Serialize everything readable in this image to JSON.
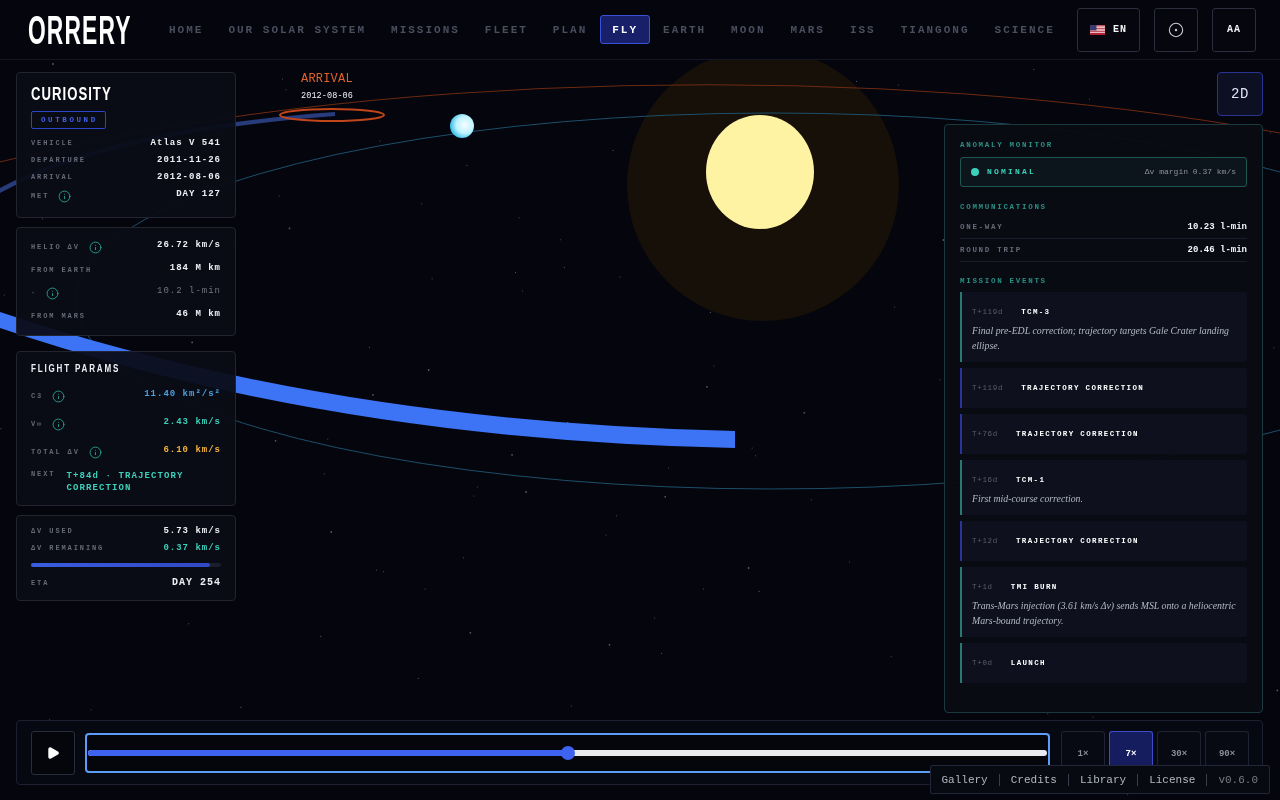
{
  "header": {
    "logo": "ORRERY",
    "nav": [
      {
        "label": "HOME",
        "selected": false
      },
      {
        "label": "OUR SOLAR SYSTEM",
        "selected": false
      },
      {
        "label": "MISSIONS",
        "selected": false
      },
      {
        "label": "FLEET",
        "selected": false
      },
      {
        "label": "PLAN",
        "selected": false
      },
      {
        "label": "FLY",
        "selected": true
      },
      {
        "label": "EARTH",
        "selected": false
      },
      {
        "label": "MOON",
        "selected": false
      },
      {
        "label": "MARS",
        "selected": false
      },
      {
        "label": "ISS",
        "selected": false
      },
      {
        "label": "TIANGONG",
        "selected": false
      },
      {
        "label": "SCIENCE",
        "selected": false
      }
    ],
    "language": "EN",
    "text_size": "AA"
  },
  "scene": {
    "arrival": {
      "title": "ARRIVAL",
      "date": "2012-08-06"
    },
    "view_mode": "2D"
  },
  "mission_card": {
    "name": "CURIOSITY",
    "status": "OUTBOUND",
    "rows": [
      {
        "label": "VEHICLE",
        "value": "Atlas V 541",
        "info": false
      },
      {
        "label": "DEPARTURE",
        "value": "2011-11-26",
        "info": false
      },
      {
        "label": "ARRIVAL",
        "value": "2012-08-06",
        "info": false
      },
      {
        "label": "MET",
        "value": "DAY 127",
        "info": true
      }
    ]
  },
  "distance_card": {
    "rows": [
      {
        "label": "HELIO ΔV",
        "value": "26.72 km/s",
        "info": true,
        "muted": false
      },
      {
        "label": "FROM EARTH",
        "value": "184 M km",
        "info": false,
        "muted": false
      },
      {
        "label": "·",
        "value": "10.2 l-min",
        "info": true,
        "muted": true
      },
      {
        "label": "FROM MARS",
        "value": "46 M km",
        "info": false,
        "muted": false
      }
    ]
  },
  "flight_params": {
    "title": "FLIGHT PARAMS",
    "rows": [
      {
        "label": "C3",
        "value": "11.40 km²/s²",
        "info": true,
        "color": "#4a9fdf"
      },
      {
        "label": "V∞",
        "value": "2.43 km/s",
        "info": true,
        "color": "#3ccfba"
      },
      {
        "label": "TOTAL ΔV",
        "value": "6.10 km/s",
        "info": true,
        "color": "#f3b43c"
      }
    ],
    "next": {
      "label": "NEXT",
      "value": "T+84d · TRAJECTORY CORRECTION"
    }
  },
  "budget_card": {
    "rows": [
      {
        "label": "ΔV USED",
        "value": "5.73 km/s",
        "color": "#eef0f5"
      },
      {
        "label": "ΔV REMAINING",
        "value": "0.37 km/s",
        "color": "#3ccfba"
      }
    ],
    "progress": {
      "level": 0.94
    },
    "eta": {
      "label": "ETA",
      "value": "DAY 254"
    }
  },
  "monitor_panel": {
    "anomaly": {
      "title": "ANOMALY MONITOR",
      "status": "NOMINAL",
      "color": "#3ccfba",
      "margin": "Δv margin 0.37 km/s"
    },
    "communications": {
      "title": "COMMUNICATIONS",
      "rows": [
        {
          "label": "ONE-WAY",
          "value": "10.23 l-min"
        },
        {
          "label": "ROUND TRIP",
          "value": "20.46 l-min"
        }
      ]
    },
    "events": {
      "title": "MISSION EVENTS",
      "items": [
        {
          "time": "T+119d",
          "title": "TCM-3",
          "description": "Final pre-EDL correction; trajectory targets Gale Crater landing ellipse.",
          "color": "#267a72"
        },
        {
          "time": "T+119d",
          "title": "TRAJECTORY CORRECTION",
          "color": "#29359a"
        },
        {
          "time": "T+76d",
          "title": "TRAJECTORY CORRECTION",
          "color": "#29359a"
        },
        {
          "time": "T+16d",
          "title": "TCM-1",
          "description": "First mid-course correction.",
          "color": "#267a72"
        },
        {
          "time": "T+12d",
          "title": "TRAJECTORY CORRECTION",
          "color": "#29359a"
        },
        {
          "time": "T+1d",
          "title": "TMI BURN",
          "description": "Trans-Mars injection (3.61 km/s Δv) sends MSL onto a heliocentric Mars-bound trajectory.",
          "color": "#267a72"
        },
        {
          "time": "T+0d",
          "title": "LAUNCH",
          "color": "#267a72"
        }
      ]
    }
  },
  "playback": {
    "timeline": {
      "level": 0.5
    },
    "speeds": [
      {
        "label": "1×",
        "selected": false
      },
      {
        "label": "7×",
        "selected": true
      },
      {
        "label": "30×",
        "selected": false
      },
      {
        "label": "90×",
        "selected": false
      }
    ]
  },
  "footer": {
    "links": [
      "Gallery",
      "Credits",
      "Library",
      "License"
    ],
    "version": "v0.6.0"
  }
}
